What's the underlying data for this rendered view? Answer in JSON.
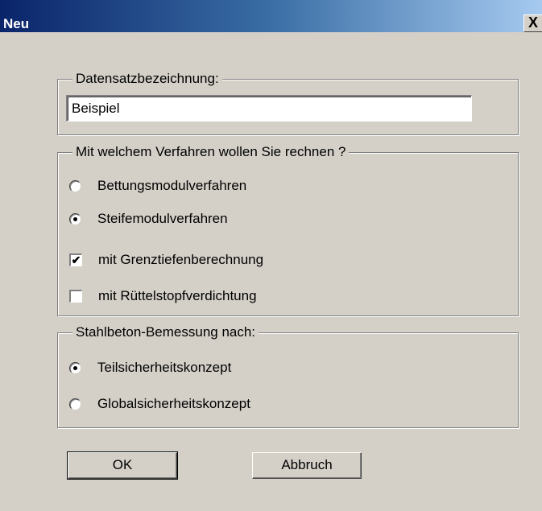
{
  "window": {
    "title": "Neu",
    "close_glyph": "X"
  },
  "dataset": {
    "legend": "Datensatzbezeichnung:",
    "value": "Beispiel"
  },
  "method": {
    "legend": "Mit welchem Verfahren wollen Sie rechnen ?",
    "options": [
      {
        "label": "Bettungsmodulverfahren",
        "type": "radio",
        "checked": false
      },
      {
        "label": "Steifemodulverfahren",
        "type": "radio",
        "checked": true
      },
      {
        "label": "mit Grenztiefenberechnung",
        "type": "checkbox",
        "checked": true
      },
      {
        "label": "mit Rüttelstopfverdichtung",
        "type": "checkbox",
        "checked": false
      }
    ]
  },
  "design": {
    "legend": "Stahlbeton-Bemessung nach:",
    "options": [
      {
        "label": "Teilsicherheitskonzept",
        "type": "radio",
        "checked": true
      },
      {
        "label": "Globalsicherheitskonzept",
        "type": "radio",
        "checked": false
      }
    ]
  },
  "buttons": {
    "ok": "OK",
    "cancel": "Abbruch"
  },
  "check_glyph": "✔"
}
